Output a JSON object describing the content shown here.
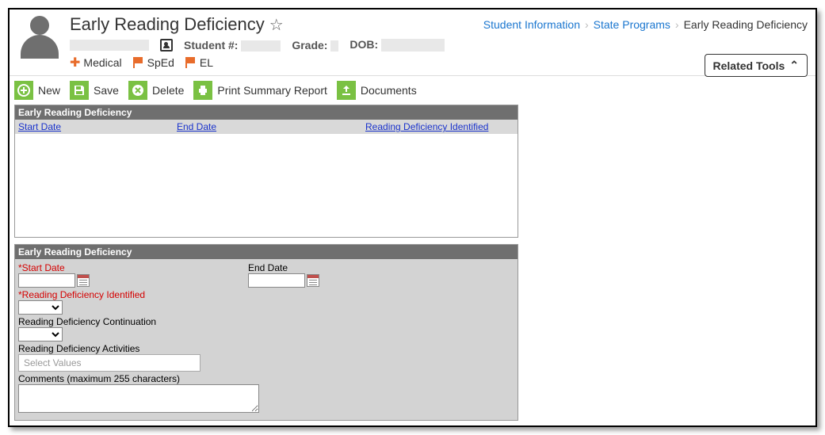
{
  "header": {
    "title": "Early Reading Deficiency",
    "student_num_label": "Student #:",
    "grade_label": "Grade:",
    "dob_label": "DOB:",
    "flags": {
      "medical": "Medical",
      "sped": "SpEd",
      "el": "EL"
    },
    "related_tools": "Related Tools"
  },
  "breadcrumbs": {
    "a": "Student Information",
    "b": "State Programs",
    "c": "Early Reading Deficiency"
  },
  "toolbar": {
    "new": "New",
    "save": "Save",
    "delete": "Delete",
    "print": "Print Summary Report",
    "docs": "Documents"
  },
  "list": {
    "title": "Early Reading Deficiency",
    "cols": {
      "start": "Start Date",
      "end": "End Date",
      "rdi": "Reading Deficiency Identified"
    }
  },
  "form": {
    "title": "Early Reading Deficiency",
    "start_label": "*Start Date",
    "end_label": "End Date",
    "rdi_label": "*Reading Deficiency Identified",
    "cont_label": "Reading Deficiency Continuation",
    "act_label": "Reading Deficiency Activities",
    "act_placeholder": "Select Values",
    "comments_label": "Comments (maximum 255 characters)"
  }
}
